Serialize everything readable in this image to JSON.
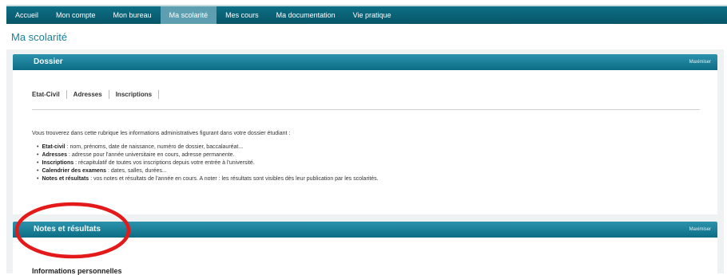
{
  "nav": {
    "items": [
      "Accueil",
      "Mon compte",
      "Mon bureau",
      "Ma scolarité",
      "Mes cours",
      "Ma documentation",
      "Vie pratique"
    ],
    "active_index": 3
  },
  "page": {
    "title": "Ma scolarité"
  },
  "dossier": {
    "title": "Dossier",
    "maximize_label": "Maximiser",
    "tabs": [
      "Etat-Civil",
      "Adresses",
      "Inscriptions"
    ],
    "intro": "Vous trouverez dans cette rubrique les informations administratives figurant dans votre dossier étudiant :",
    "bullets": [
      {
        "term": "Etat-civil",
        "text": " : nom, prénoms, date de naissance, numéro de dossier, baccalauréat..."
      },
      {
        "term": "Adresses",
        "text": " : adresse pour l'année universitaire en cours, adresse permanente."
      },
      {
        "term": "Inscriptions",
        "text": " : récapitulatif de toutes vos inscriptions depuis votre entrée à l'université."
      },
      {
        "term": "Calendrier des examens",
        "text": " : dates, salles, durées..."
      },
      {
        "term": "Notes et résultats",
        "text": " : vos notes et résultats de l'année en cours. A noter : les résultats sont visibles dès leur publication par les scolarités."
      }
    ]
  },
  "notes": {
    "title": "Notes et résultats",
    "maximize_label": "Maximiser",
    "subtitle": "Informations personnelles"
  },
  "colors": {
    "nav_bg": "#075567",
    "nav_active": "#5d9fb0",
    "header_bg": "#1a7f98",
    "title": "#1b8197",
    "annotation": "#e41a1a"
  }
}
